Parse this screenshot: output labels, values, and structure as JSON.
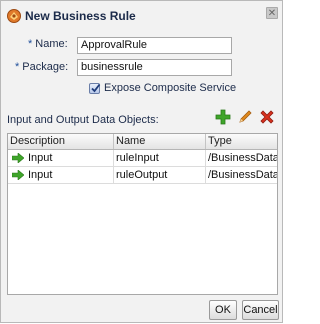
{
  "dialog": {
    "title": "New Business Rule",
    "close_glyph": "✕"
  },
  "form": {
    "name_required": "*",
    "name_label": "Name:",
    "name_value": "ApprovalRule",
    "package_required": "*",
    "package_label": "Package:",
    "package_value": "businessrule",
    "expose_label": "Expose Composite Service",
    "expose_checked": true
  },
  "data_objects": {
    "label": "Input and Output Data Objects:",
    "toolbar": [
      "add-icon",
      "edit-icon",
      "delete-icon"
    ],
    "columns": [
      "Description",
      "Name",
      "Type"
    ],
    "rows": [
      {
        "description": "Input",
        "name": "ruleInput",
        "type": "/BusinessData/Ru"
      },
      {
        "description": "Input",
        "name": "ruleOutput",
        "type": "/BusinessData/Ru"
      }
    ]
  },
  "buttons": {
    "ok": "OK",
    "cancel": "Cancel"
  },
  "colors": {
    "accent_green": "#3fa52a",
    "delete_red": "#d8321f",
    "edit_orange": "#e08a1e"
  }
}
